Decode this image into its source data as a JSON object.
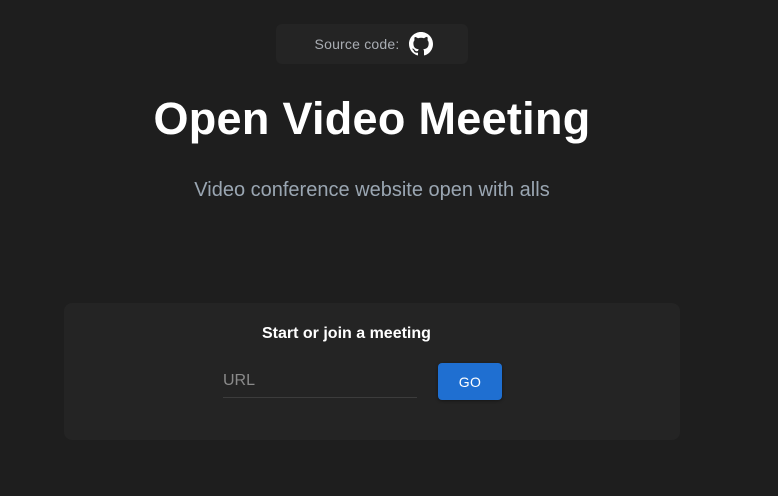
{
  "header": {
    "source_label": "Source code:",
    "source_icon": "github-icon"
  },
  "hero": {
    "title": "Open Video Meeting",
    "subtitle": "Video conference website open with alls"
  },
  "meeting_card": {
    "heading": "Start or join a meeting",
    "url_placeholder": "URL",
    "url_value": "",
    "go_label": "GO"
  },
  "colors": {
    "background": "#1e1e1e",
    "card": "#242424",
    "accent": "#1f6fd1",
    "subtitle": "#9aa6b2"
  }
}
